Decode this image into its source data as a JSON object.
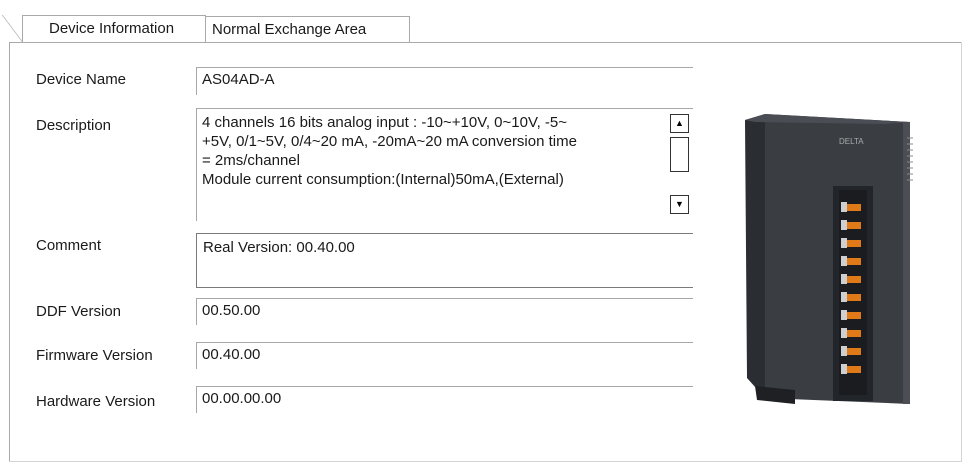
{
  "tabs": [
    {
      "label": "Device Information",
      "active": true
    },
    {
      "label": "Normal Exchange Area",
      "active": false
    }
  ],
  "fields": {
    "device_name": {
      "label": "Device Name",
      "value": "AS04AD-A"
    },
    "description": {
      "label": "Description",
      "value": "4 channels 16 bits analog input : -10~+10V, 0~10V, -5~\n+5V, 0/1~5V, 0/4~20 mA, -20mA~20 mA conversion time\n= 2ms/channel\nModule current consumption:(Internal)50mA,(External)"
    },
    "comment": {
      "label": "Comment",
      "value": "Real Version: 00.40.00"
    },
    "ddf_version": {
      "label": "DDF Version",
      "value": "00.50.00"
    },
    "firmware_version": {
      "label": "Firmware Version",
      "value": "00.40.00"
    },
    "hardware_version": {
      "label": "Hardware Version",
      "value": "00.00.00.00"
    }
  },
  "icons": {
    "scroll_up": "▲",
    "scroll_down": "▼"
  },
  "device_image": {
    "brand_text": "DELTA"
  }
}
